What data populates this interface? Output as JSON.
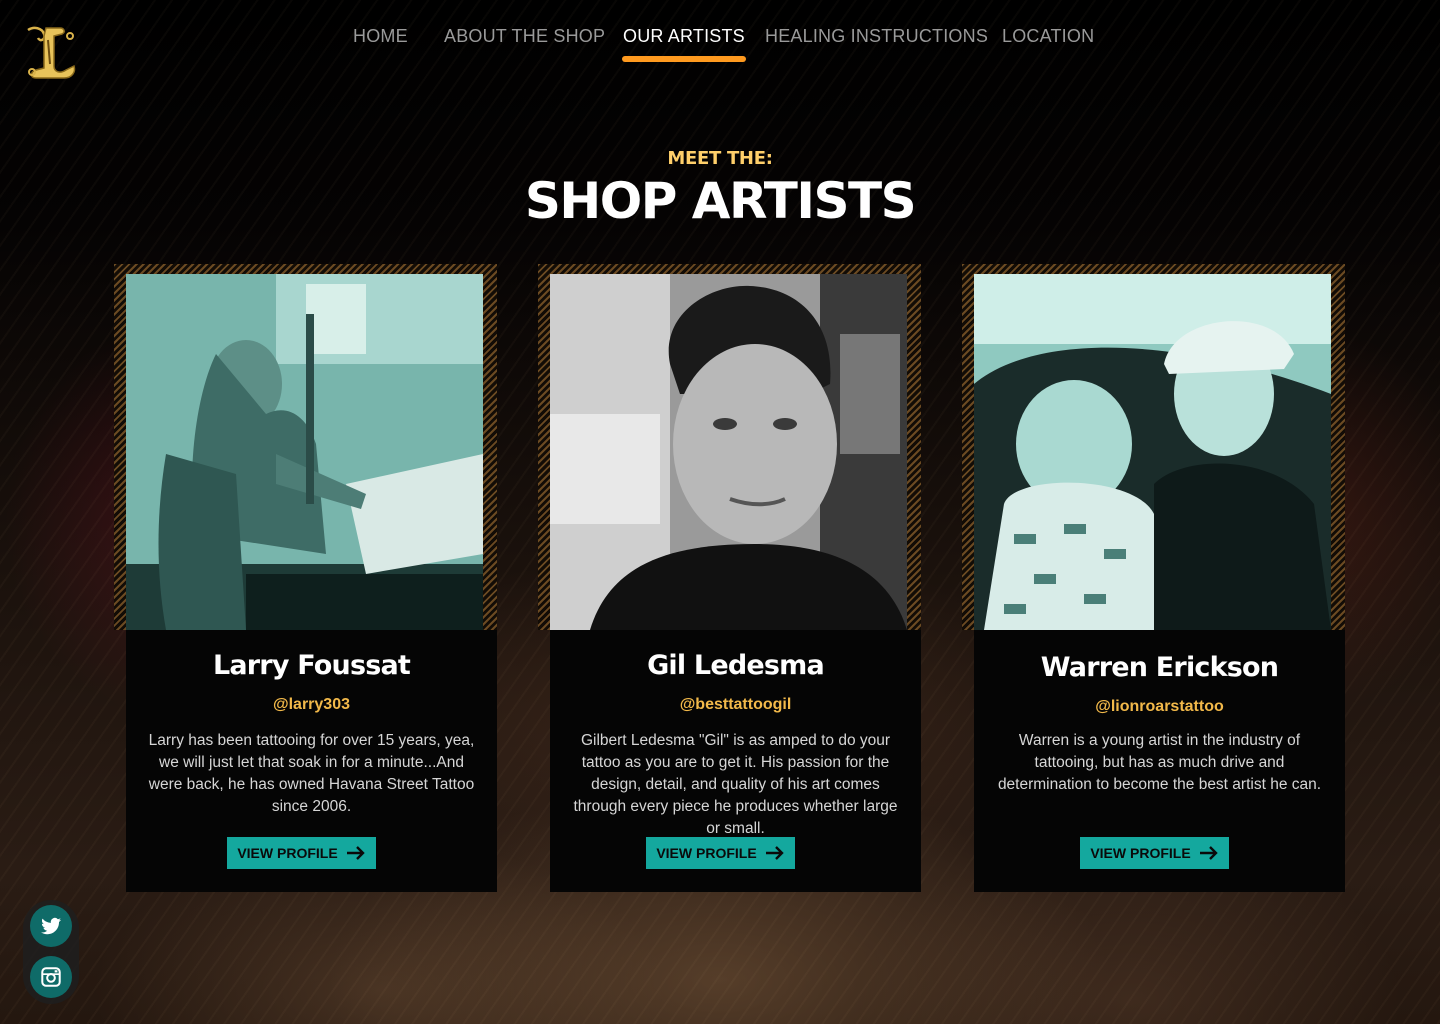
{
  "brand": {
    "logo_letter": "L"
  },
  "nav": {
    "items": [
      {
        "label": "HOME"
      },
      {
        "label": "ABOUT THE SHOP"
      },
      {
        "label": "OUR ARTISTS",
        "active": true
      },
      {
        "label": "HEALING INSTRUCTIONS"
      },
      {
        "label": "LOCATION"
      }
    ]
  },
  "hero": {
    "kicker": "MEET THE:",
    "title": "SHOP ARTISTS"
  },
  "artists": [
    {
      "name": "Larry Foussat",
      "handle": "@larry303",
      "bio": "Larry has been tattooing for over 15 years, yea, we will just let that soak in for a minute...And were back, he has owned Havana Street Tattoo since 2006.",
      "button": "VIEW PROFILE",
      "photo_tint": "teal"
    },
    {
      "name": "Gil Ledesma",
      "handle": "@besttattoogil",
      "bio": "Gilbert Ledesma \"Gil\" is as amped to do your tattoo as you are to get it. His passion for the design, detail, and quality of his art comes through every piece he produces whether large or small.",
      "button": "VIEW PROFILE",
      "photo_tint": "grayscale"
    },
    {
      "name": "Warren Erickson",
      "handle": "@lionroarstattoo",
      "bio": "Warren is a young artist in the industry of tattooing, but has as much drive and determination to become the best artist he can.",
      "button": "VIEW PROFILE",
      "photo_tint": "teal"
    }
  ],
  "social": [
    {
      "icon": "twitter-icon"
    },
    {
      "icon": "instagram-icon"
    }
  ],
  "colors": {
    "accent_orange": "#ff9a1f",
    "handle_gold": "#f2b94a",
    "kicker_gold": "#ffcf6a",
    "button_teal": "#14a89e",
    "social_teal": "#0f6b68"
  }
}
